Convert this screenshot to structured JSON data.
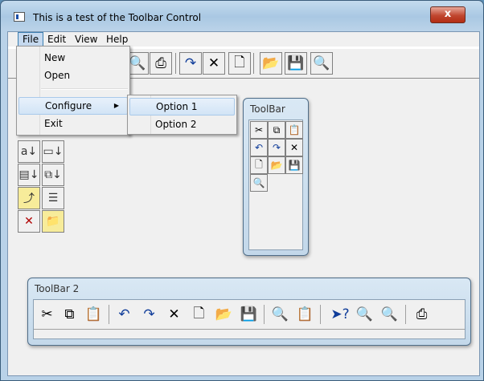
{
  "window": {
    "title": "This is a test of the Toolbar Control",
    "close_glyph": "x"
  },
  "menubar": {
    "items": [
      {
        "label": "File"
      },
      {
        "label": "Edit"
      },
      {
        "label": "View"
      },
      {
        "label": "Help"
      }
    ]
  },
  "file_menu": {
    "items": [
      {
        "label": "New"
      },
      {
        "label": "Open"
      },
      {
        "label": "Configure"
      },
      {
        "label": "Exit"
      }
    ],
    "submenu_arrow": "▶"
  },
  "configure_submenu": {
    "items": [
      {
        "label": "Option 1"
      },
      {
        "label": "Option 2"
      }
    ]
  },
  "main_toolbar": {
    "glyphs": {
      "find_replace": "🔍",
      "print": "⎙",
      "redo": "↷",
      "delete": "✕",
      "new": "🗋",
      "open": "📂",
      "save": "💾",
      "print_preview": "🔍"
    }
  },
  "left_toolbar": {
    "glyphs": {
      "sort_az": "a↓",
      "sort_shape": "▭↓",
      "sort_doc": "▤↓",
      "copy_sort": "⧉↓",
      "up_folder": "⤴",
      "new_folder_line": "☰",
      "cut_line": "✕",
      "new_folder": "📁"
    }
  },
  "toolbar_1": {
    "title": "ToolBar",
    "glyphs": {
      "cut": "✂",
      "copy": "⧉",
      "paste": "📋",
      "undo": "↶",
      "redo": "↷",
      "delete": "✕",
      "new": "🗋",
      "open": "📂",
      "save": "💾",
      "print_preview": "🔍"
    }
  },
  "toolbar_2": {
    "title": "ToolBar 2",
    "glyphs": {
      "cut": "✂",
      "copy": "⧉",
      "paste": "📋",
      "undo": "↶",
      "redo": "↷",
      "delete": "✕",
      "new": "🗋",
      "open": "📂",
      "save": "💾",
      "print_preview": "🔍",
      "properties": "📋",
      "help": "➤?",
      "find": "🔍",
      "replace": "🔍",
      "print": "⎙"
    }
  },
  "colors": {
    "title_bar": "#b9d2e8",
    "client_bg": "#f0f0f0",
    "close_button": "#c0462f",
    "menu_highlight": "#c5d9ef",
    "float_frame": "#c3d8ea"
  }
}
